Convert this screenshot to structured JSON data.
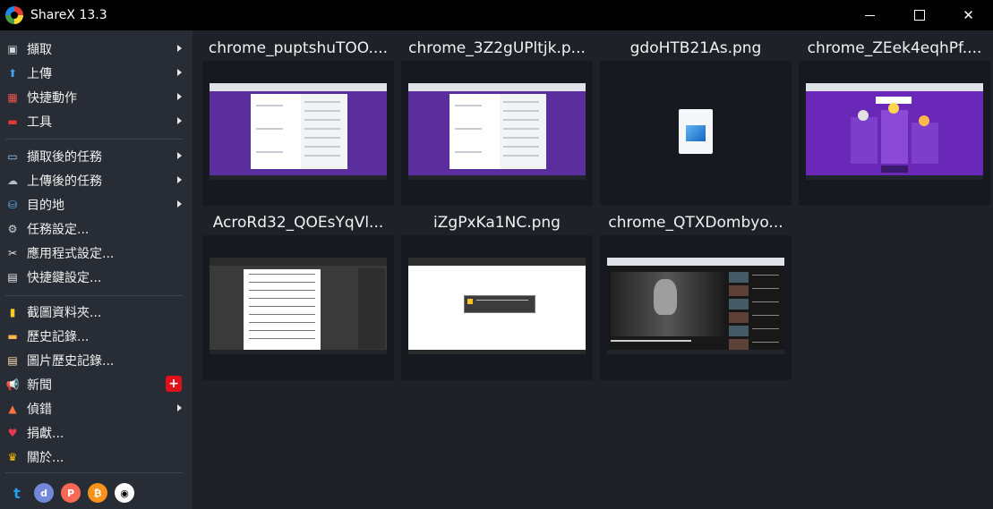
{
  "window": {
    "title": "ShareX 13.3",
    "minimize_icon": "minimize-icon",
    "maximize_icon": "maximize-icon",
    "close_icon": "close-icon",
    "close_glyph": "✕"
  },
  "sidebar": {
    "items": [
      {
        "label": "擷取",
        "icon": "capture-icon",
        "submenu": true
      },
      {
        "label": "上傳",
        "icon": "upload-icon",
        "submenu": true
      },
      {
        "label": "快捷動作",
        "icon": "workflows-icon",
        "submenu": true
      },
      {
        "label": "工具",
        "icon": "tools-icon",
        "submenu": true
      },
      {
        "label": "擷取後的任務",
        "icon": "after-capture-icon",
        "submenu": true
      },
      {
        "label": "上傳後的任務",
        "icon": "after-upload-icon",
        "submenu": true
      },
      {
        "label": "目的地",
        "icon": "destinations-icon",
        "submenu": true
      },
      {
        "label": "任務設定...",
        "icon": "gear-icon",
        "submenu": false
      },
      {
        "label": "應用程式設定...",
        "icon": "wrench-icon",
        "submenu": false
      },
      {
        "label": "快捷鍵設定...",
        "icon": "keyboard-icon",
        "submenu": false
      },
      {
        "label": "截圖資料夾...",
        "icon": "folder-icon",
        "submenu": false
      },
      {
        "label": "歷史記錄...",
        "icon": "history-icon",
        "submenu": false
      },
      {
        "label": "圖片歷史記錄...",
        "icon": "image-history-icon",
        "submenu": false
      },
      {
        "label": "新聞",
        "icon": "megaphone-icon",
        "submenu": false,
        "badge": "+"
      },
      {
        "label": "偵錯",
        "icon": "debug-icon",
        "submenu": true
      },
      {
        "label": "捐獻...",
        "icon": "heart-icon",
        "submenu": false
      },
      {
        "label": "關於...",
        "icon": "crown-icon",
        "submenu": false
      }
    ],
    "social": [
      {
        "name": "twitter-icon",
        "color": "#1da1f2"
      },
      {
        "name": "discord-icon",
        "color": "#7289da"
      },
      {
        "name": "patreon-icon",
        "color": "#f96854"
      },
      {
        "name": "bitcoin-icon",
        "color": "#f7931a"
      },
      {
        "name": "github-icon",
        "color": "#ffffff"
      }
    ]
  },
  "thumbnails": [
    {
      "title": "chrome_puptshuTOO....",
      "kind": "form-purple"
    },
    {
      "title": "chrome_3Z2gUPltjk.p...",
      "kind": "form-purple"
    },
    {
      "title": "gdoHTB21As.png",
      "kind": "file-icon"
    },
    {
      "title": "chrome_ZEek4eqhPf....",
      "kind": "game-purple"
    },
    {
      "title": "AcroRd32_QOEsYqVl...",
      "kind": "pdf"
    },
    {
      "title": "iZgPxKa1NC.png",
      "kind": "dialog-white"
    },
    {
      "title": "chrome_QTXDombyo...",
      "kind": "video"
    }
  ],
  "colors": {
    "background": "#1e2127",
    "sidebar": "#282c34",
    "titlebar": "#000000",
    "thumb_bg": "#161a20",
    "purple": "#5a2e9c"
  }
}
